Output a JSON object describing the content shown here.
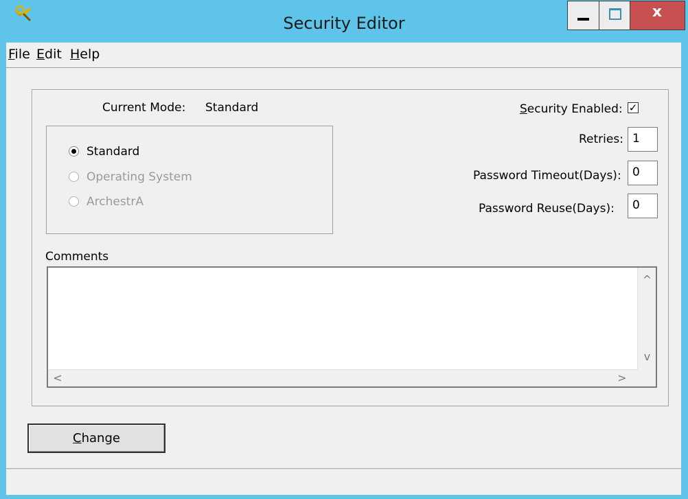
{
  "window": {
    "title": "Security Editor",
    "close_glyph": "x"
  },
  "menu": {
    "items": [
      {
        "key": "F",
        "rest": "ile"
      },
      {
        "key": "E",
        "rest": "dit"
      },
      {
        "key": "H",
        "rest": "elp"
      }
    ]
  },
  "mode": {
    "current_label": "Current Mode:",
    "current_value": "Standard",
    "options": [
      {
        "label": "Standard",
        "selected": true,
        "enabled": true
      },
      {
        "label": "Operating System",
        "selected": false,
        "enabled": false
      },
      {
        "label": "ArchestrA",
        "selected": false,
        "enabled": false
      }
    ]
  },
  "settings": {
    "security_enabled_key": "S",
    "security_enabled_rest": "ecurity Enabled:",
    "security_enabled": true,
    "check_glyph": "✓",
    "retries_label": "Retries:",
    "retries_value": "1",
    "pwd_timeout_label": "Password Timeout(Days):",
    "pwd_timeout_value": "0",
    "pwd_reuse_label": "Password Reuse(Days):",
    "pwd_reuse_value": "0"
  },
  "comments": {
    "label": "Comments",
    "value": ""
  },
  "buttons": {
    "change_key": "C",
    "change_rest": "hange"
  },
  "icons": {
    "app": "key-tools-icon",
    "scroll_up": "^",
    "scroll_down": "v",
    "scroll_left": "<",
    "scroll_right": ">"
  },
  "colors": {
    "titlebar": "#5ec4e9",
    "close_button": "#c75050",
    "client": "#f0f0f0"
  }
}
